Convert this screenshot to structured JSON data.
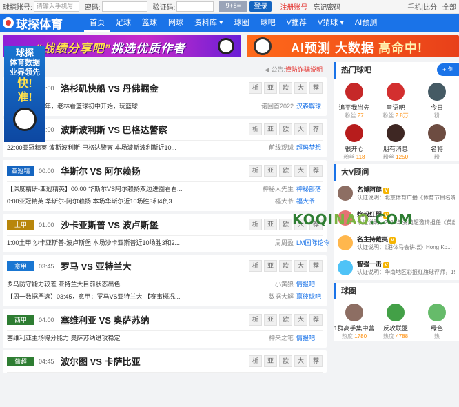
{
  "topbar": {
    "account_label": "球探账号:",
    "account_placeholder": "请输入手机号",
    "password_label": "密码:",
    "captcha_label": "验证码:",
    "captcha_text": "9+8=",
    "login_label": "登录",
    "register_label": "注册账号",
    "forgot_label": "忘记密码",
    "mobile_label": "手机|比分",
    "all_label": "全部"
  },
  "header": {
    "logo_text": "球探体育",
    "nav": [
      "首页",
      "足球",
      "篮球",
      "网球",
      "资料库 ▾",
      "球圈",
      "球吧",
      "V推荐",
      "V猜球 ▾",
      "AI预测"
    ]
  },
  "banners": {
    "left_pre": "“战绩分享吧”",
    "left_text": "挑选优质作者",
    "right_text": "AI预测 大数据",
    "right_hl": "高命中!"
  },
  "float_ad": {
    "line1": "球探",
    "line2": "体育数据",
    "line3": "业界领先",
    "line4": "快!",
    "line5": "准!"
  },
  "notice": {
    "label": "公告:",
    "text": "谨防诈骗说明"
  },
  "matches": [
    {
      "tag": "",
      "tag_color": "#ffffff",
      "time": "00:00",
      "teams": "洛杉矶快船 VS 丹佛掘金",
      "rows": [
        {
          "t": "人研究足篮 9 年，老林看篮球初中开始，玩篮球...",
          "au": "诺回首2022",
          "lk": "汉森解球"
        }
      ]
    },
    {
      "tag": "",
      "tag_color": "#ffffff",
      "time": "22:00",
      "teams": "波斯波利斯 VS 巴格达警察",
      "rows": [
        {
          "t": "22:00亚冠精英 波斯波利斯-巴格达警察 本场波斯波利斯近10...",
          "au": "前线观球",
          "lk": "超玛梦想"
        }
      ]
    },
    {
      "tag": "亚冠精英",
      "tag_color": "#1565c0",
      "time": "00:00",
      "teams": "华斯尔 VS 阿尔赖扬",
      "rows": [
        {
          "t": "【深度精研-亚冠精英】00:00 华斯尔VS阿尔赖扬双边进圈看看...",
          "au": "神秘人先生",
          "lk": "神秘部落"
        },
        {
          "t": "0:00亚冠精英 华斯尔-阿尔赖扬 本场华斯尔近10场胜3和4负3...",
          "au": "福大爷",
          "lk": "福大爷"
        }
      ]
    },
    {
      "tag": "土甲",
      "tag_color": "#b8860b",
      "time": "01:00",
      "teams": "沙卡亚斯普 VS 波卢斯堡",
      "rows": [
        {
          "t": "1:00土甲 沙卡亚斯普-波卢斯堡 本场沙卡亚斯普近10场胜3和2...",
          "au": "周周盈",
          "lk": "LM国际论令"
        }
      ]
    },
    {
      "tag": "意甲",
      "tag_color": "#1976d2",
      "time": "03:45",
      "teams": "罗马 VS 亚特兰大",
      "rows": [
        {
          "t": "罗马防守能力较差 亚特兰大目前状态出色",
          "au": "小黄狼",
          "lk": "情报吧"
        },
        {
          "t": "【周一数据严选】03:45，意甲：罗马VS亚特兰大 【赛事概况...",
          "au": "数据大解",
          "lk": "赢彼球吧"
        }
      ]
    },
    {
      "tag": "西甲",
      "tag_color": "#2e7d32",
      "time": "04:00",
      "teams": "塞维利亚 VS 奥萨苏纳",
      "rows": [
        {
          "t": "塞维利亚主场得分能力 奥萨苏纳进攻稳定",
          "au": "神来之笔",
          "lk": "情报吧"
        }
      ]
    },
    {
      "tag": "葡超",
      "tag_color": "#2e7d32",
      "time": "04:45",
      "teams": "波尔图 VS 卡萨比亚",
      "rows": []
    }
  ],
  "ops": [
    "析",
    "亚",
    "欧",
    "大",
    "荐"
  ],
  "right": {
    "hot_title": "热门球吧",
    "follow_label": "+ 创",
    "hot_items": [
      {
        "name": "追平我当先",
        "fans_label": "粉丝",
        "fans": "27",
        "color": "#c62828"
      },
      {
        "name": "粤语吧",
        "fans_label": "粉丝",
        "fans": "2.8万",
        "color": "#d32f2f"
      },
      {
        "name": "今日",
        "fans_label": "粉",
        "fans": "",
        "color": "#455a64"
      },
      {
        "name": "很开心",
        "fans_label": "粉丝",
        "fans": "118",
        "color": "#b71c1c"
      },
      {
        "name": "朋有消息",
        "fans_label": "粉丝",
        "fans": "1250",
        "color": "#3e2723"
      },
      {
        "name": "名将",
        "fans_label": "粉",
        "fans": "",
        "color": "#6d4c41"
      }
    ],
    "v_title": "大V顾问",
    "v_items": [
      {
        "name": "名博阿健",
        "desc": "认证说明：北京体育广播《体育节目名嘴-阿",
        "color": "#8d6e63"
      },
      {
        "name": "炮叔红胆",
        "desc": "认证说明：2019年受英超邀请担任《英超",
        "color": "#e57373"
      },
      {
        "name": "名主持戴夷",
        "desc": "认证说明：《港体马会讲坛》Hong Ko...",
        "color": "#ffb74d"
      },
      {
        "name": "智强一击",
        "desc": "认证说明：华南地区彩报红旗球评师，19",
        "color": "#4fc3f7"
      }
    ],
    "circle_title": "球圈",
    "circle_items": [
      {
        "name": "1群高手集中营",
        "heat_label": "热度",
        "heat": "1780",
        "color": "#8d6e63"
      },
      {
        "name": "反攻联盟",
        "heat_label": "热度",
        "heat": "4788",
        "color": "#43a047"
      },
      {
        "name": "绿色",
        "heat_label": "热",
        "heat": "",
        "color": "#66bb6a"
      }
    ]
  },
  "watermark": {
    "a": "KOQI",
    "b": "NAO",
    "c": ".COM"
  }
}
